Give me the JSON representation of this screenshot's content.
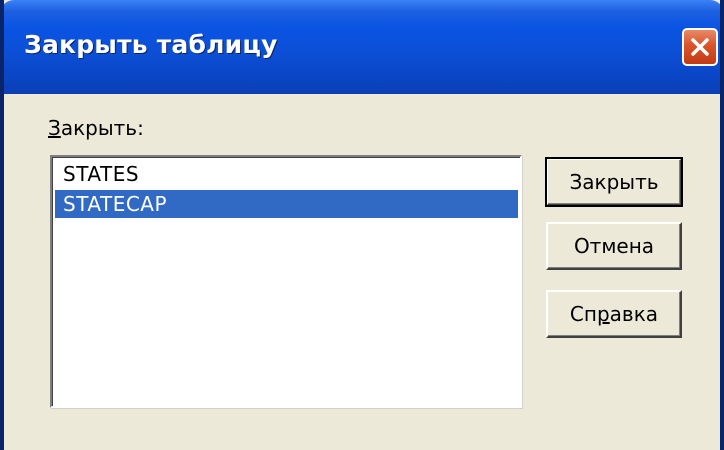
{
  "window": {
    "title": "Закрыть таблицу"
  },
  "dialog": {
    "list_label_accel": "З",
    "list_label_rest": "акрыть:",
    "tables": [
      {
        "name": "STATES",
        "selected": false
      },
      {
        "name": "STATECAP",
        "selected": true
      }
    ]
  },
  "buttons": {
    "close_label": "Закрыть",
    "cancel_label": "Отмена",
    "help_label_pre": "Сп",
    "help_label_accel": "р",
    "help_label_post": "авка"
  },
  "icons": {
    "close": "close-x-icon"
  },
  "colors": {
    "titlebar": "#0a54e3",
    "selection": "#316ac5",
    "dialog_bg": "#ece9d8",
    "close_button": "#d9542b"
  }
}
